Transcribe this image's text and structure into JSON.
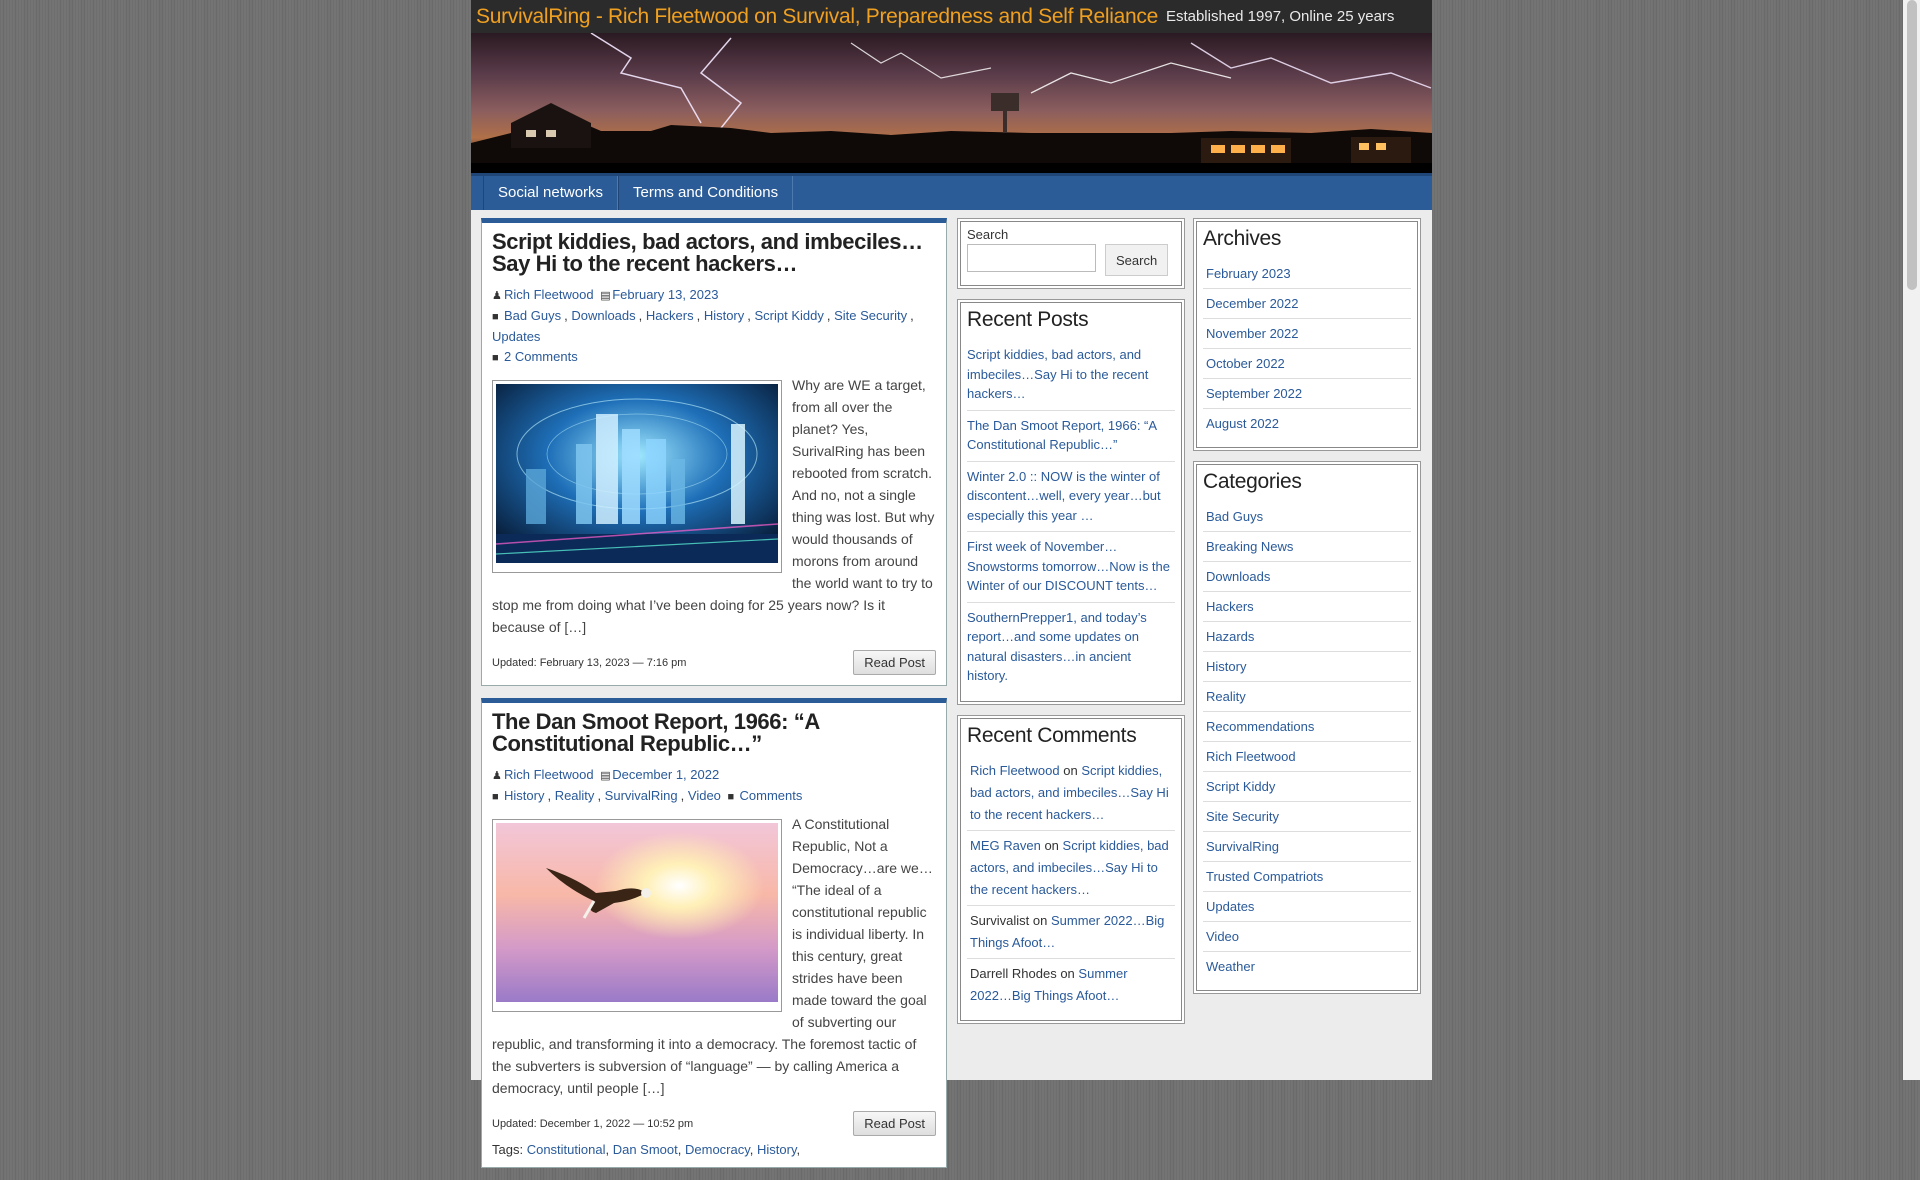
{
  "header": {
    "site_title": "SurvivalRing - Rich Fleetwood on Survival, Preparedness and Self Reliance",
    "tagline": "Established 1997, Online 25 years"
  },
  "nav": [
    "Social networks",
    "Terms and Conditions"
  ],
  "posts": [
    {
      "title": "Script kiddies, bad actors, and imbeciles…Say Hi to the recent hackers…",
      "author": "Rich Fleetwood",
      "date": "February 13, 2023",
      "categories": [
        "Bad Guys",
        "Downloads",
        "Hackers",
        "History",
        "Script Kiddy",
        "Site Security",
        "Updates"
      ],
      "comments": "2 Comments",
      "excerpt": "Why are WE a target, from all over the planet? Yes, SurivalRing has been rebooted from scratch. And no, not a single thing was lost. But why would thousands of morons from around the world want to try to stop me from doing what I’ve been doing for 25 years now? Is it because of […]",
      "updated": "Updated: February 13, 2023 — 7:16 pm",
      "read_label": "Read Post"
    },
    {
      "title": "The Dan Smoot Report, 1966: “A Constitutional Republic…”",
      "author": "Rich Fleetwood",
      "date": "December 1, 2022",
      "categories": [
        "History",
        "Reality",
        "SurvivalRing",
        "Video"
      ],
      "comments": "Comments",
      "excerpt": "A Constitutional Republic, Not a Democracy…are we… “The ideal of a constitutional republic is individual liberty. In this century, great strides have been made toward the goal of subverting our republic, and transforming it into a democracy. The foremost tactic of the subverters is subversion of “language” — by calling America a democracy, until people […]",
      "updated": "Updated: December 1, 2022 — 10:52 pm",
      "read_label": "Read Post",
      "tags_label": "Tags:",
      "tags": [
        "Constitutional",
        "Dan Smoot",
        "Democracy",
        "History"
      ]
    }
  ],
  "search": {
    "label": "Search",
    "button": "Search",
    "value": ""
  },
  "recent_posts": {
    "title": "Recent Posts",
    "items": [
      "Script kiddies, bad actors, and imbeciles…Say Hi to the recent hackers…",
      "The Dan Smoot Report, 1966: “A Constitutional Republic…”",
      "Winter 2.0 :: NOW is the winter of discontent…well, every year…but especially this year …",
      "First week of November…Snowstorms tomorrow…Now is the Winter of our DISCOUNT tents…",
      "SouthernPrepper1, and today’s report…and some updates on natural disasters…in ancient history."
    ]
  },
  "recent_comments": {
    "title": "Recent Comments",
    "on": "on",
    "items": [
      {
        "author": "Rich Fleetwood",
        "author_link": true,
        "post": "Script kiddies, bad actors, and imbeciles…Say Hi to the recent hackers…"
      },
      {
        "author": "MEG Raven",
        "author_link": true,
        "post": "Script kiddies, bad actors, and imbeciles…Say Hi to the recent hackers…"
      },
      {
        "author": "Survivalist",
        "author_link": false,
        "post": "Summer 2022…Big Things Afoot…"
      },
      {
        "author": "Darrell Rhodes",
        "author_link": false,
        "post": "Summer 2022…Big Things Afoot…"
      }
    ]
  },
  "archives": {
    "title": "Archives",
    "items": [
      "February 2023",
      "December 2022",
      "November 2022",
      "October 2022",
      "September 2022",
      "August 2022"
    ]
  },
  "categories": {
    "title": "Categories",
    "items": [
      "Bad Guys",
      "Breaking News",
      "Downloads",
      "Hackers",
      "Hazards",
      "History",
      "Reality",
      "Recommendations",
      "Rich Fleetwood",
      "Script Kiddy",
      "Site Security",
      "SurvivalRing",
      "Trusted Compatriots",
      "Updates",
      "Video",
      "Weather"
    ]
  },
  "colors": {
    "accent": "#2b5c97",
    "title": "#f0a020",
    "link": "#2a5a9a"
  }
}
